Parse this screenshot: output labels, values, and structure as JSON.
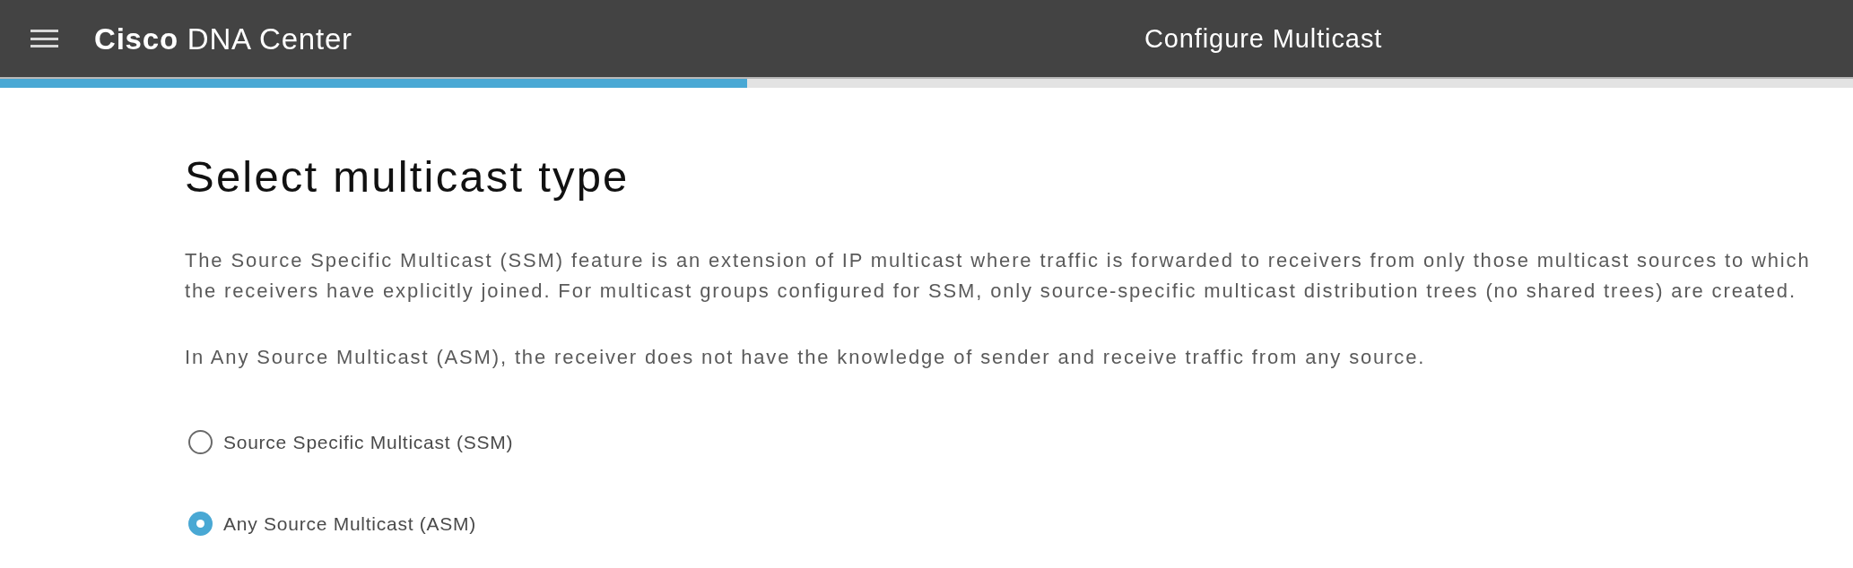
{
  "header": {
    "logo": "**Cisco** DNA Center",
    "title": "Configure Multicast"
  },
  "progress": {
    "level": 0.403
  },
  "heading": "Select multicast type",
  "paragraphs": [
    "The Source Specific Multicast (SSM) feature is an extension of IP multicast where traffic is forwarded to receivers from only those multicast sources to which the receivers have explicitly joined. For multicast groups configured for SSM, only source-specific multicast distribution trees (no shared trees) are created.",
    "In Any Source Multicast (ASM), the receiver does not have the knowledge of sender and receive traffic from any source."
  ],
  "options": [
    {
      "label": "Source Specific Multicast (SSM)",
      "selected": false
    },
    {
      "label": "Any Source Multicast (ASM)",
      "selected": true
    }
  ]
}
